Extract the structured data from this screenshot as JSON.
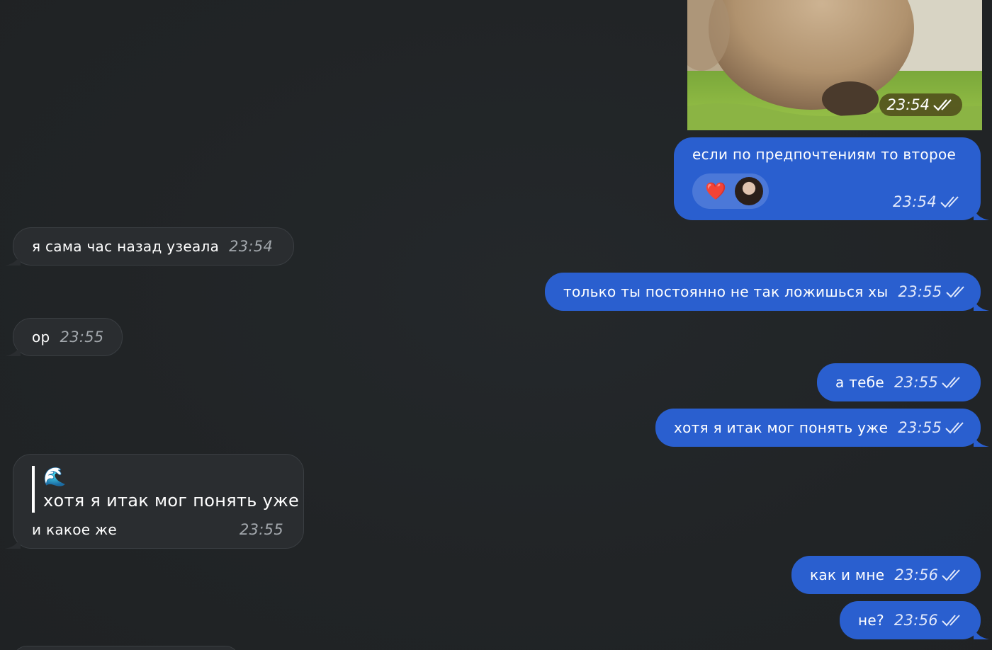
{
  "photo_message": {
    "time": "23:54"
  },
  "messages": [
    {
      "text": "если по предпочтениям то второе",
      "time": "23:54",
      "reaction": "❤️"
    },
    {
      "text": "я сама час назад узеала",
      "time": "23:54"
    },
    {
      "text": "только ты постоянно не так ложишься хы",
      "time": "23:55"
    },
    {
      "text": "ор",
      "time": "23:55"
    },
    {
      "text": "а тебе",
      "time": "23:55"
    },
    {
      "text": "хотя я итак мог понять уже",
      "time": "23:55"
    },
    {
      "quote_emoji": "🌊",
      "quote_text": "хотя я итак мог понять уже",
      "text": "и какое же",
      "time": "23:55"
    },
    {
      "text": "как и мне",
      "time": "23:56"
    },
    {
      "text": "не?",
      "time": "23:56"
    }
  ],
  "colors": {
    "background": "#212426",
    "outgoing_bubble": "#2a5fcf",
    "incoming_bubble": "#2a2d30"
  }
}
